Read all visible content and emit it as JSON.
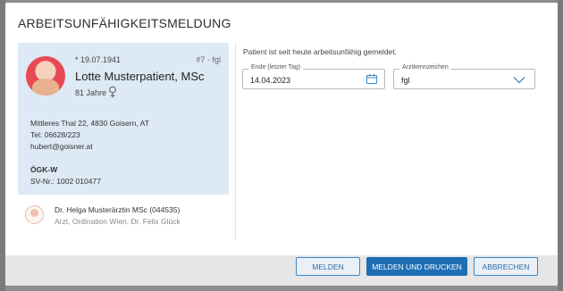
{
  "dialog": {
    "title": "ARBEITSUNFÄHIGKEITSMELDUNG"
  },
  "patient": {
    "dob": "* 19.07.1941",
    "record": "#7 - fgl",
    "name": "Lotte Musterpatient, MSc",
    "age": "81 Jahre",
    "address": "Mittleres Thal 22, 4830 Goisern, AT",
    "phone": "Tel: 06628/223",
    "email": "hubert@goisner.at",
    "insurance_name": "ÖGK-W",
    "ssn": "SV-Nr.: 1002 010477"
  },
  "doctor": {
    "name": "Dr. Helga Musterärztin MSc (044535)",
    "subtitle": "Arzt, Ordination Wien, Dr. Felix Glück"
  },
  "form": {
    "notice": "Patient ist seit heute arbeitsunfähig gemeldet.",
    "end_date_label": "Ende (letzter Tag)",
    "end_date_value": "14.04.2023",
    "sign_label": "Arztkennzeichen",
    "sign_value": "fgl"
  },
  "buttons": {
    "melden": "MELDEN",
    "melden_drucken": "MELDEN UND DRUCKEN",
    "abbrechen": "ABBRECHEN"
  },
  "colors": {
    "primary": "#1e6eb5",
    "card_bg": "#dde9f4",
    "footer_bg": "#e6e6e6"
  },
  "icons": {
    "gender": "female-icon",
    "date": "calendar-icon",
    "dropdown": "chevron-down-icon"
  }
}
